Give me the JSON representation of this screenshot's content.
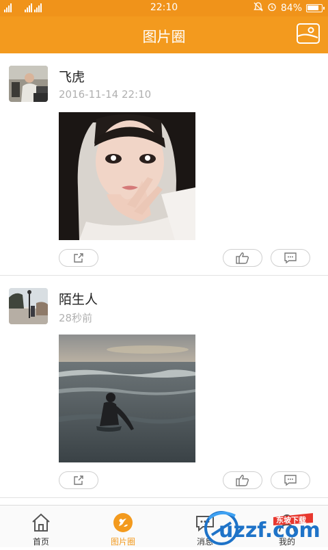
{
  "status_bar": {
    "signal_text": "2G 4G 4G",
    "time": "22:10",
    "battery_percent": "84%",
    "battery_level": 0.84
  },
  "header": {
    "title": "图片圈"
  },
  "posts": [
    {
      "name": "飞虎",
      "time": "2016-11-14 22:10"
    },
    {
      "name": "陌生人",
      "time": "28秒前"
    }
  ],
  "tabs": [
    {
      "label": "首页"
    },
    {
      "label": "图片圈"
    },
    {
      "label": "消息"
    },
    {
      "label": "我的"
    }
  ],
  "watermark": {
    "text": "uzzf.com",
    "tag": "东坡下载"
  },
  "colors": {
    "accent": "#f39a1e",
    "status": "#f0931a"
  }
}
